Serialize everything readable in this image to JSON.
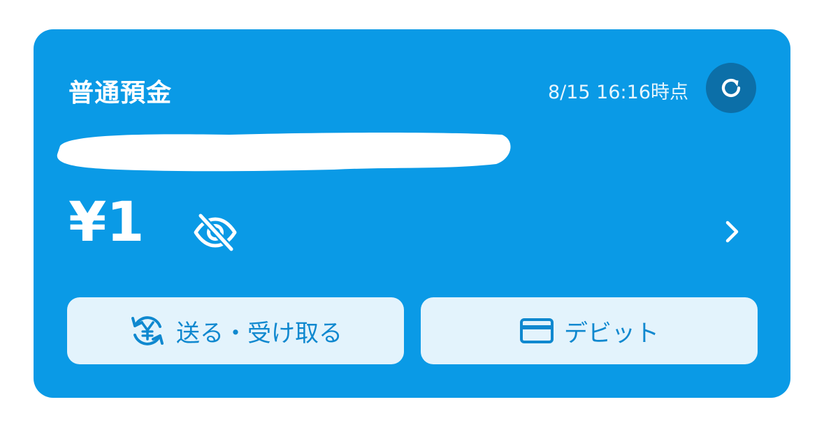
{
  "account": {
    "title": "普通預金",
    "timestamp": "8/15 16:16時点",
    "balance": "¥1"
  },
  "icons": {
    "refresh": "refresh-icon",
    "visibility": "eye-off-icon",
    "chevron": "chevron-right-icon",
    "transfer": "yen-transfer-icon",
    "card": "credit-card-icon"
  },
  "actions": {
    "send_receive_label": "送る・受け取る",
    "debit_label": "デビット"
  },
  "colors": {
    "card_bg": "#0a9ae6",
    "refresh_bg": "#0c6fa8",
    "button_bg": "#e3f3fc",
    "button_text": "#0f88cf"
  }
}
